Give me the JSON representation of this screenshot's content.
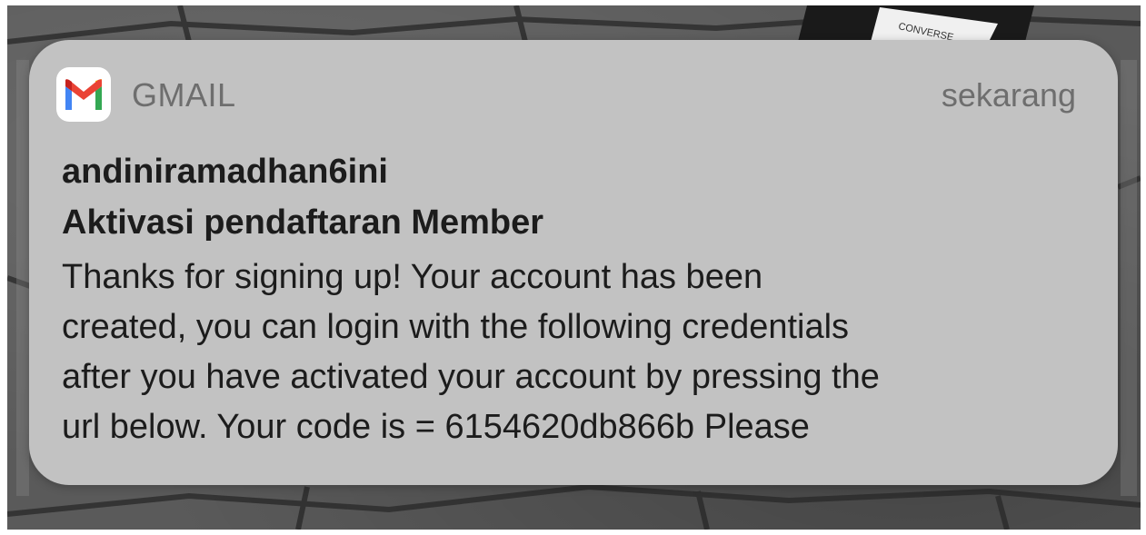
{
  "notification": {
    "app_name": "GMAIL",
    "app_icon": "gmail-icon",
    "timestamp": "sekarang",
    "sender": "andiniramadhan6ini",
    "subject": "Aktivasi pendaftaran Member",
    "body_lines": [
      "Thanks for signing up! Your account has been",
      "created, you can login with the following credentials",
      "after you have activated your account by pressing the",
      "url below. Your code is = 6154620db866b Please"
    ]
  },
  "colors": {
    "card_background": "#c2c2c2",
    "gmail_red": "#EA4335",
    "gmail_blue": "#4285F4",
    "gmail_green": "#34A853",
    "gmail_yellow": "#FBBC04",
    "gmail_dark_red": "#C5221F"
  },
  "background": {
    "photo_text": "CONVERSE"
  }
}
